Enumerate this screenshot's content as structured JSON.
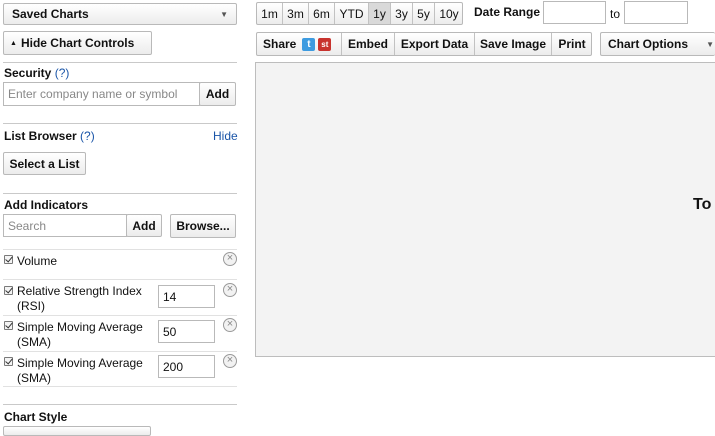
{
  "sidebar": {
    "saved_charts": "Saved Charts",
    "hide_controls": "Hide Chart Controls",
    "security": {
      "heading": "Security",
      "help": "(?)",
      "placeholder": "Enter company name or symbol",
      "add": "Add"
    },
    "list_browser": {
      "heading": "List Browser",
      "help": "(?)",
      "hide": "Hide",
      "select": "Select a List"
    },
    "indicators": {
      "heading": "Add Indicators",
      "placeholder": "Search",
      "add": "Add",
      "browse": "Browse...",
      "items": [
        {
          "label": "Volume",
          "value": ""
        },
        {
          "label": "Relative Strength Index (RSI)",
          "value": "14"
        },
        {
          "label": "Simple Moving Average (SMA)",
          "value": "50"
        },
        {
          "label": "Simple Moving Average (SMA)",
          "value": "200"
        }
      ]
    },
    "chart_style": {
      "heading": "Chart Style"
    }
  },
  "toolbar": {
    "ranges": [
      "1m",
      "3m",
      "6m",
      "YTD",
      "1y",
      "3y",
      "5y",
      "10y"
    ],
    "active_range": "1y",
    "date_range_label": "Date Range",
    "to_label": "to",
    "share": "Share",
    "embed": "Embed",
    "export": "Export Data",
    "save_image": "Save Image",
    "print": "Print",
    "chart_options": "Chart Options"
  },
  "chart": {
    "overflow_text": "To"
  },
  "colors": {
    "link": "#1a55a8",
    "border": "#b9b9b9",
    "twitter": "#3d9be0",
    "stocktwits": "#c8332e"
  }
}
